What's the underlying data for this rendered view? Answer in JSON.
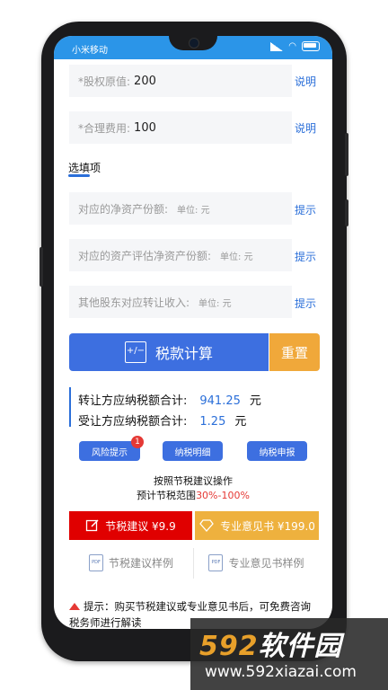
{
  "status": {
    "carrier": "小米移动"
  },
  "form": {
    "required": [
      {
        "label": "*股权原值:",
        "value": "200",
        "link": "说明"
      },
      {
        "label": "*合理费用:",
        "value": "100",
        "link": "说明"
      }
    ],
    "optional_title": "选填项",
    "optional": [
      {
        "label": "对应的净资产份额:",
        "unit": "单位: 元",
        "link": "提示"
      },
      {
        "label": "对应的资产评估净资产份额:",
        "unit": "单位: 元",
        "link": "提示"
      },
      {
        "label": "其他股东对应转让收入:",
        "unit": "单位: 元",
        "link": "提示"
      }
    ]
  },
  "buttons": {
    "calculate": "税款计算",
    "calculate_icon": "+/−",
    "reset": "重置"
  },
  "summary": [
    {
      "label": "转让方应纳税额合计:",
      "value": "941.25",
      "currency": "元"
    },
    {
      "label": "受让方应纳税额合计:",
      "value": "1.25",
      "currency": "元"
    }
  ],
  "actions": [
    {
      "label": "风险提示",
      "badge": "1"
    },
    {
      "label": "纳税明细"
    },
    {
      "label": "纳税申报"
    }
  ],
  "advice": {
    "line1": "按照节税建议操作",
    "line2_prefix": "预计节税范围",
    "range": "30%-100%"
  },
  "purchase": [
    {
      "label": "节税建议 ¥9.9",
      "color": "#e00000",
      "icon": "edit-icon"
    },
    {
      "label": "专业意见书 ¥199.0",
      "color": "#eeb13e",
      "icon": "diamond-icon"
    }
  ],
  "samples": [
    {
      "label": "节税建议样例",
      "icon_text": "PDF"
    },
    {
      "label": "专业意见书样例",
      "icon_text": "PDF"
    }
  ],
  "tip": "提示：购买节税建议或专业意见书后，可免费咨询税务师进行解读",
  "watermark": {
    "logo_num": "592",
    "logo_text": "软件园",
    "url": "www.592xiazai.com"
  },
  "colors": {
    "primary": "#3d6fe0",
    "accent": "#f0a83a",
    "danger": "#e53935",
    "statusbar": "#2b95e8"
  }
}
